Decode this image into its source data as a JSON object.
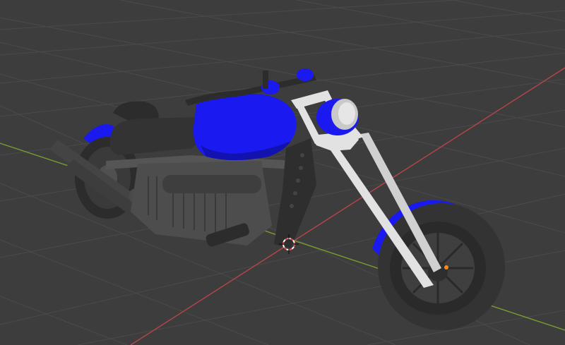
{
  "viewport": {
    "background_color": "#3d3d3d",
    "grid_color": "#4a4a4a",
    "x_axis_color": "#b8444a",
    "y_axis_color": "#7a9c2e"
  },
  "model": {
    "paint_color": "#1a1af0",
    "paint_shadow_color": "#1212b0",
    "body_color": "#4a4a4a",
    "dark_color": "#2c2c2c",
    "chrome_color": "#e2e2e2",
    "tire_color": "#333333"
  },
  "scene_cursor": {
    "icon": "3d-cursor-icon",
    "ring_color_a": "#e05050",
    "ring_color_b": "#ffffff"
  },
  "origin_marker": {
    "icon": "object-origin-icon",
    "color": "#ff8a1a"
  }
}
